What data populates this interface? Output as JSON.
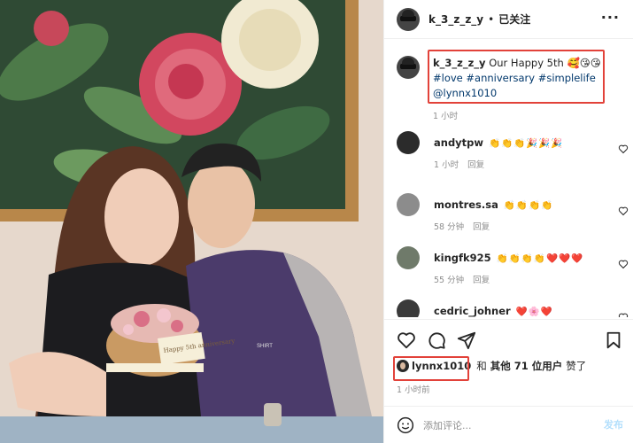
{
  "photo": {
    "cake_text": "Happy 5th anniversary",
    "shirt_text": "SHIRT"
  },
  "header": {
    "username": "k_3_z_z_y",
    "separator": "•",
    "follow_label": "已关注",
    "more_label": "···"
  },
  "caption": {
    "username": "k_3_z_z_y",
    "text": "Our Happy 5th",
    "emojis": "🥰😘😘",
    "hashtags": "#love #anniversary #simplelife",
    "mention": "@lynnx1010",
    "time": "1 小时"
  },
  "comments": [
    {
      "username": "andytpw",
      "emojis": "👏👏👏🎉🎉🎉",
      "time": "1 小时",
      "reply": "回复"
    },
    {
      "username": "montres.sa",
      "emojis": "👏👏👏👏",
      "time": "58 分钟",
      "reply": "回复"
    },
    {
      "username": "kingfk925",
      "emojis": "👏👏👏👏❤️❤️❤️",
      "time": "55 分钟",
      "reply": "回复"
    },
    {
      "username": "cedric_johner",
      "emojis": "❤️🌸❤️",
      "time": "",
      "reply": ""
    }
  ],
  "likes": {
    "user": "lynnx1010",
    "and": "和",
    "others": "其他 71 位用户",
    "suffix": "赞了"
  },
  "post_time": "1 小时前",
  "comment_box": {
    "placeholder": "添加评论...",
    "post_label": "发布"
  },
  "colors": {
    "highlight_box": "#e2423a",
    "link": "#00376b",
    "muted": "#8e8e8e"
  }
}
